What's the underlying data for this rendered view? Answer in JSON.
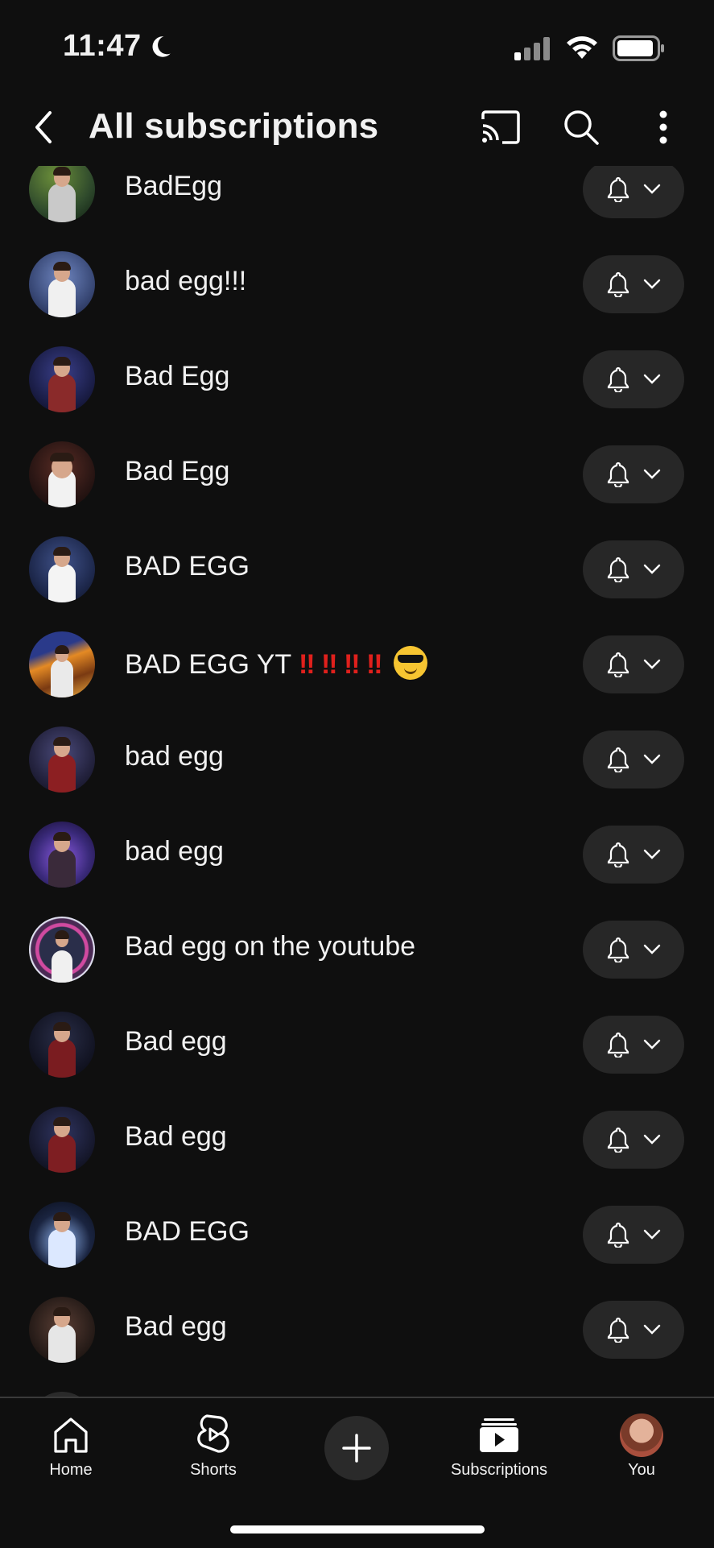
{
  "status_bar": {
    "time": "11:47"
  },
  "header": {
    "title": "All subscriptions",
    "back_icon": "chevron-left-icon",
    "cast_icon": "cast-icon",
    "search_icon": "search-icon",
    "more_icon": "more-vert-icon"
  },
  "subscriptions": [
    {
      "name": "BadEgg",
      "bg": "#2f4a2c"
    },
    {
      "name": "bad egg!!!",
      "bg": "#3a4a78"
    },
    {
      "name": "Bad Egg",
      "bg": "#1c1f4a"
    },
    {
      "name": "Bad Egg",
      "bg": "#2a1614"
    },
    {
      "name": "BAD EGG",
      "bg": "#1f2a4f"
    },
    {
      "name": "BAD EGG YT",
      "bg": "#7a3a12"
    },
    {
      "name": "bad egg",
      "bg": "#24233f"
    },
    {
      "name": "bad egg",
      "bg": "#3a2a7a"
    },
    {
      "name": "Bad egg on the youtube",
      "bg": "#4a2a54"
    },
    {
      "name": "Bad egg",
      "bg": "#141626"
    },
    {
      "name": "Bad egg",
      "bg": "#181a30"
    },
    {
      "name": "BAD EGG",
      "bg": "#1a2440"
    },
    {
      "name": "Bad egg",
      "bg": "#2a1e1a"
    }
  ],
  "bottom_nav": {
    "home": "Home",
    "shorts": "Shorts",
    "subscriptions": "Subscriptions",
    "you": "You"
  },
  "colors": {
    "background": "#0f0f0f",
    "pill": "#272727",
    "text": "#f1f1f1",
    "exclamation": "#e0201c"
  }
}
